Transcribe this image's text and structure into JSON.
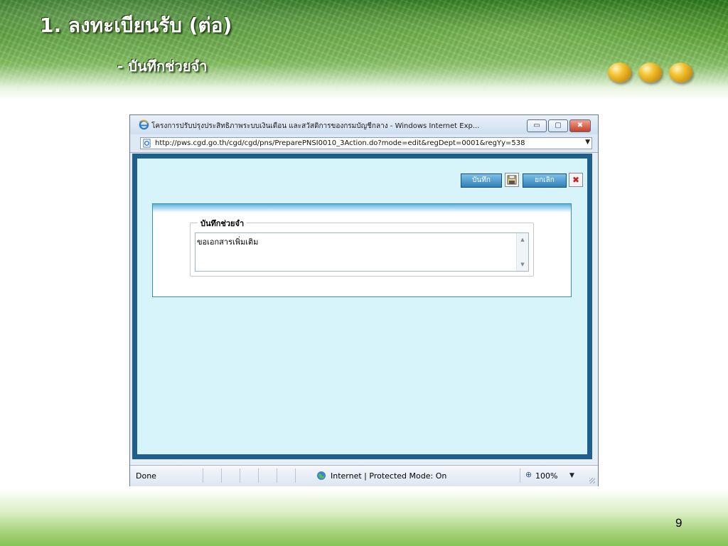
{
  "slide": {
    "title": "1. ลงทะเบียนรับ (ต่อ)",
    "subtitle": "- บันทึกช่วยจำ",
    "page_number": "9"
  },
  "browser": {
    "window_title": "โครงการปรับปรุงประสิทธิภาพระบบเงินเดือน และสวัสดิการของกรมบัญชีกลาง - Windows Internet Exp...",
    "address_url": "http://pws.cgd.go.th/cgd/cgd/pns/PreparePNSI0010_3Action.do?mode=edit&regDept=0001&regYy=538",
    "minimize_label": "▭",
    "maximize_label": "▢",
    "close_label": "✖"
  },
  "form": {
    "save_label": "บันทึก",
    "cancel_label": "ยกเลิก",
    "memo_legend": "บันทึกช่วยจำ",
    "memo_value": "ขอเอกสารเพิ่มเติม"
  },
  "statusbar": {
    "status": "Done",
    "zone": "Internet | Protected Mode: On",
    "zoom": "100%"
  },
  "colors": {
    "frame_blue": "#1e5f8c",
    "content_bg": "#d8f4fb",
    "button_blue": "#2f7fb8",
    "bullet_gold": "#f2c230"
  },
  "icons": {
    "browser": "ie-logo-icon",
    "page": "page-icon",
    "save": "floppy-disk-icon",
    "cancel": "red-x-icon",
    "zone": "globe-icon",
    "zoom": "magnifier-icon"
  }
}
